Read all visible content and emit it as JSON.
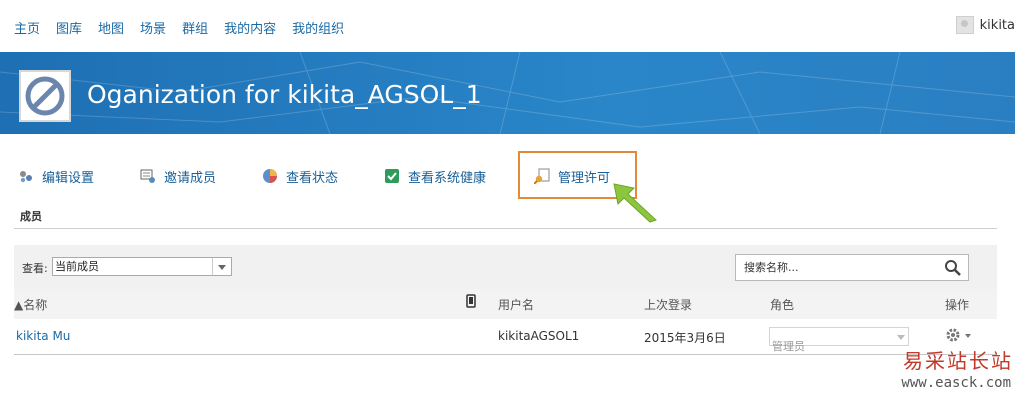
{
  "nav": {
    "links": [
      "主页",
      "图库",
      "地图",
      "场景",
      "群组",
      "我的内容",
      "我的组织"
    ],
    "username": "kikita"
  },
  "banner": {
    "title": "Oganization for kikita_AGSOL_1"
  },
  "tools": {
    "edit_settings": "编辑设置",
    "invite_members": "邀请成员",
    "view_status": "查看状态",
    "view_health": "查看系统健康",
    "manage_licenses": "管理许可"
  },
  "section": {
    "members_label": "成员"
  },
  "filter": {
    "view_label": "查看:",
    "view_value": "当前成员",
    "search_placeholder": "搜索名称..."
  },
  "table": {
    "headers": {
      "name": "▲名称",
      "username": "用户名",
      "last_login": "上次登录",
      "role": "角色",
      "actions": "操作"
    },
    "rows": [
      {
        "name": "kikita Mu",
        "username": "kikitaAGSOL1",
        "last_login": "2015年3月6日",
        "role": "管理员"
      }
    ]
  },
  "watermark": {
    "text": "易采站长站",
    "url": "www.easck.com"
  },
  "colors": {
    "highlight_border": "#e08a3c",
    "arrow": "#8cc63f",
    "banner": "#2a7fc2",
    "link": "#1a6aa5"
  }
}
